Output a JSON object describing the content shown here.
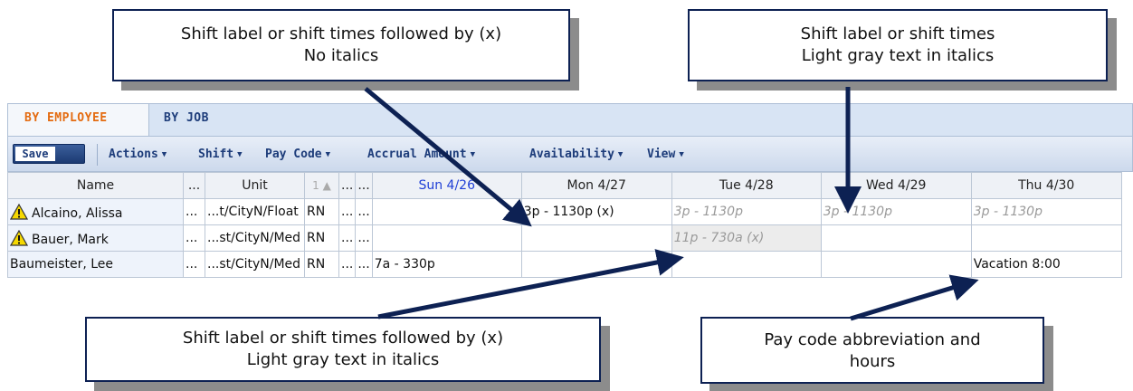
{
  "tabs": {
    "active": "BY EMPLOYEE",
    "inactive": "BY JOB"
  },
  "toolbar": {
    "save": "Save",
    "menus": [
      "Actions",
      "Shift",
      "Pay Code",
      "Accrual Amount",
      "Availability",
      "View"
    ],
    "caret": "▼"
  },
  "grid": {
    "headers": {
      "name": "Name",
      "dots1": "...",
      "unit": "Unit",
      "job": "1 ▲",
      "dots2": "...",
      "dots3": "...",
      "sun": "Sun 4/26",
      "mon": "Mon 4/27",
      "tue": "Tue 4/28",
      "wed": "Wed 4/29",
      "thu": "Thu 4/30"
    },
    "rows": [
      {
        "name": "Alcaino, Alissa",
        "warning": true,
        "dots1": "...",
        "unit": "...t/CityN/Float",
        "job": "RN",
        "dots2": "...",
        "dots3": "...",
        "sun": "",
        "mon": "3p - 1130p (x)",
        "tue": "3p - 1130p",
        "wed": "3p - 1130p",
        "thu": "3p - 1130p"
      },
      {
        "name": "Bauer, Mark",
        "warning": true,
        "dots1": "...",
        "unit": "...st/CityN/Med",
        "job": "RN",
        "dots2": "...",
        "dots3": "...",
        "sun": "",
        "mon": "",
        "tue": "11p - 730a (x)",
        "wed": "",
        "thu": ""
      },
      {
        "name": "Baumeister, Lee",
        "warning": false,
        "dots1": "...",
        "unit": "...st/CityN/Med",
        "job": "RN",
        "dots2": "...",
        "dots3": "...",
        "sun": "7a - 330p",
        "mon": "",
        "tue": "",
        "wed": "",
        "thu": "Vacation 8:00"
      }
    ]
  },
  "callouts": {
    "top_left": {
      "line1": "Shift label or shift times followed by (x)",
      "line2": "No italics"
    },
    "top_right": {
      "line1": "Shift label or shift times",
      "line2": "Light gray text in italics"
    },
    "bottom_left": {
      "line1": "Shift label or shift times followed by (x)",
      "line2": "Light gray text in italics"
    },
    "bottom_right": {
      "line1": "Pay code abbreviation and",
      "line2": "hours"
    }
  },
  "colors": {
    "accent_tab": "#e46b10",
    "nav_text": "#1d3c7a",
    "today_header": "#1f3fd6",
    "callout_border": "#0d2153"
  }
}
